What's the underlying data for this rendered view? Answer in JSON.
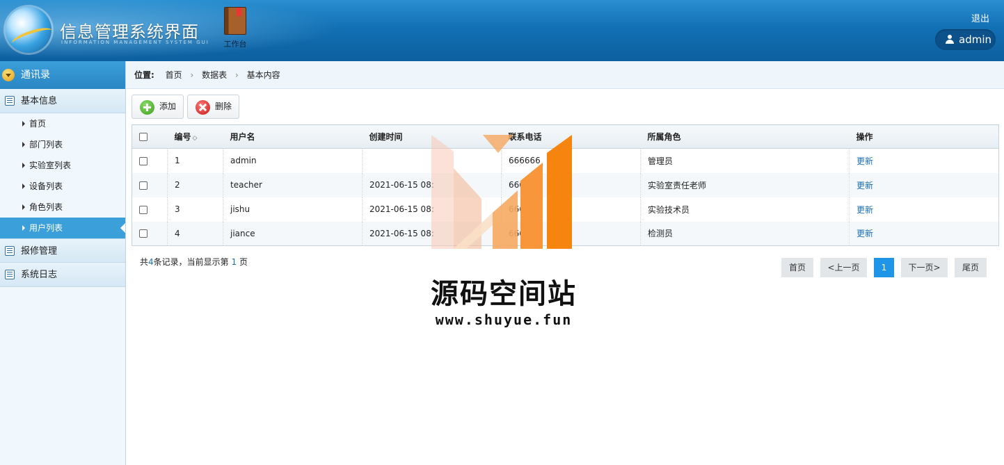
{
  "header": {
    "title": "信息管理系统界面",
    "subtitle": "INFORMATION MANAGEMENT SYSTEM GUI",
    "workbench_label": "工作台",
    "logout_label": "退出",
    "username": "admin"
  },
  "sidebar": {
    "top_label": "通讯录",
    "groups": [
      {
        "label": "基本信息",
        "icon": "list-icon"
      },
      {
        "label": "报修管理",
        "icon": "edit-icon"
      },
      {
        "label": "系统日志",
        "icon": "message-icon"
      }
    ],
    "items": [
      {
        "label": "首页"
      },
      {
        "label": "部门列表"
      },
      {
        "label": "实验室列表"
      },
      {
        "label": "设备列表"
      },
      {
        "label": "角色列表"
      },
      {
        "label": "用户列表",
        "active": true
      }
    ]
  },
  "breadcrumb": {
    "prefix": "位置:",
    "parts": [
      "首页",
      "数据表",
      "基本内容"
    ]
  },
  "toolbar": {
    "add_label": "添加",
    "delete_label": "删除"
  },
  "table": {
    "columns": [
      "编号",
      "用户名",
      "创建时间",
      "联系电话",
      "所属角色",
      "操作"
    ],
    "sort_icon": "◇",
    "rows": [
      {
        "id": "1",
        "username": "admin",
        "created": "",
        "phone": "666666",
        "role": "管理员",
        "action": "更新"
      },
      {
        "id": "2",
        "username": "teacher",
        "created": "2021-06-15 08:",
        "phone": "6666",
        "role": "实验室责任老师",
        "action": "更新"
      },
      {
        "id": "3",
        "username": "jishu",
        "created": "2021-06-15 08:",
        "phone": "666",
        "role": "实验技术员",
        "action": "更新"
      },
      {
        "id": "4",
        "username": "jiance",
        "created": "2021-06-15 08:",
        "phone": "666",
        "role": "检测员",
        "action": "更新"
      }
    ]
  },
  "pagination": {
    "summary_pre": "共",
    "total": "4",
    "summary_mid": "条记录，当前显示第",
    "current": "1",
    "summary_post": "页",
    "first": "首页",
    "prev": "<上一页",
    "page": "1",
    "next": "下一页>",
    "last": "尾页"
  },
  "watermark": {
    "text": "源码空间站",
    "url": "www.shuyue.fun"
  },
  "colors": {
    "header_blue": "#1270b4",
    "accent_blue": "#3b9fd9",
    "link_blue": "#1b6fb5",
    "page_active": "#1e95e6",
    "watermark_orange": "#f5850f"
  }
}
